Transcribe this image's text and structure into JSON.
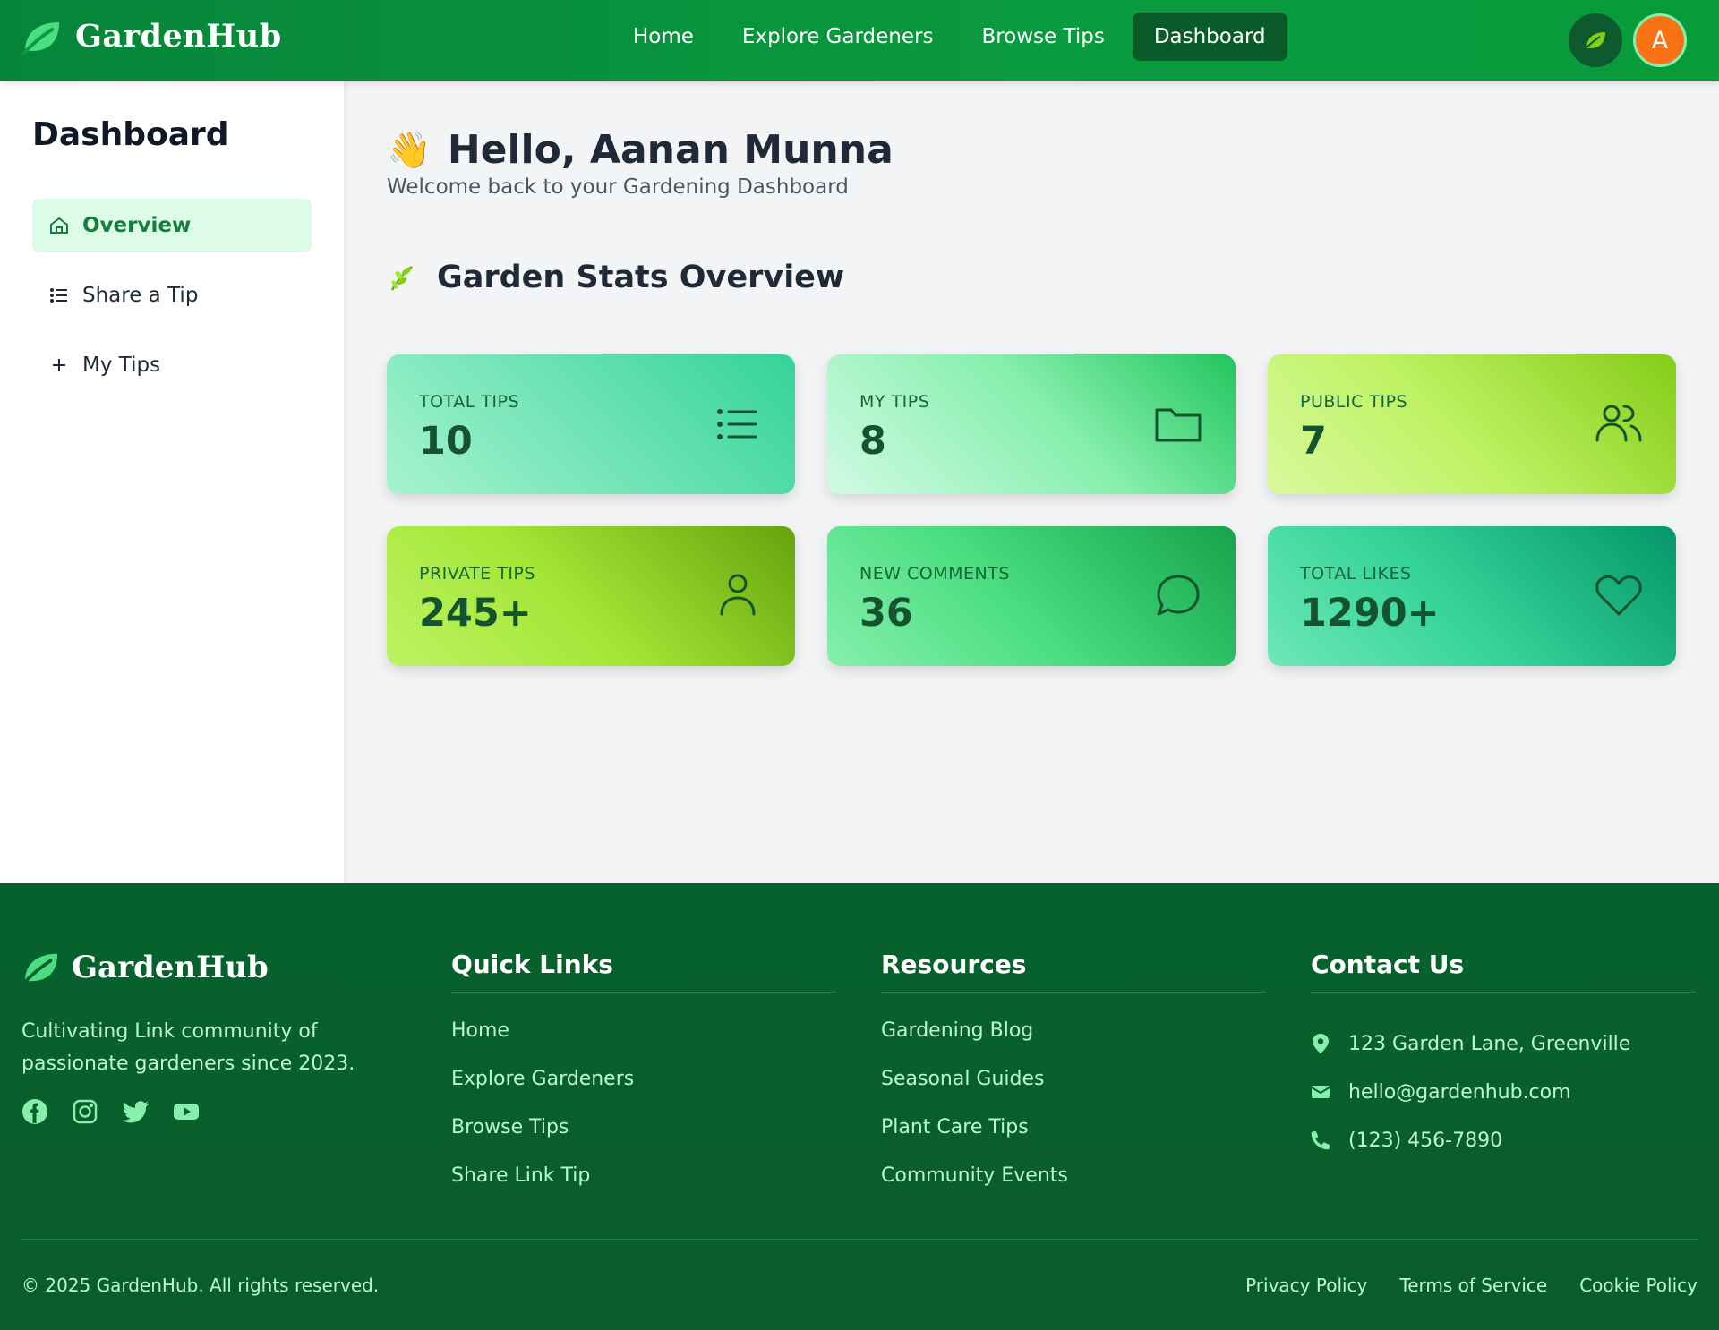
{
  "header": {
    "brand": "GardenHub",
    "nav": [
      {
        "label": "Home"
      },
      {
        "label": "Explore Gardeners"
      },
      {
        "label": "Browse Tips"
      },
      {
        "label": "Dashboard",
        "active": true
      }
    ],
    "avatar_initial": "A"
  },
  "sidebar": {
    "title": "Dashboard",
    "items": [
      {
        "label": "Overview",
        "icon": "home-icon",
        "active": true
      },
      {
        "label": "Share a Tip",
        "icon": "list-icon"
      },
      {
        "label": "My Tips",
        "icon": "plus-icon"
      }
    ]
  },
  "main": {
    "greeting": "Hello, Aanan Munna",
    "welcome": "Welcome back to your Gardening Dashboard",
    "stats_title": "Garden Stats Overview",
    "stats": [
      {
        "label": "TOTAL TIPS",
        "value": "10",
        "icon": "list-icon"
      },
      {
        "label": "MY TIPS",
        "value": "8",
        "icon": "folder-icon"
      },
      {
        "label": "PUBLIC TIPS",
        "value": "7",
        "icon": "users-icon"
      },
      {
        "label": "PRIVATE TIPS",
        "value": "245+",
        "icon": "user-icon"
      },
      {
        "label": "NEW COMMENTS",
        "value": "36",
        "icon": "comment-icon"
      },
      {
        "label": "TOTAL LIKES",
        "value": "1290+",
        "icon": "heart-icon"
      }
    ]
  },
  "footer": {
    "brand": "GardenHub",
    "description": "Cultivating Link community of passionate gardeners since 2023.",
    "social": [
      "facebook-icon",
      "instagram-icon",
      "twitter-icon",
      "youtube-icon"
    ],
    "quick_links": {
      "title": "Quick Links",
      "items": [
        "Home",
        "Explore Gardeners",
        "Browse Tips",
        "Share Link Tip"
      ]
    },
    "resources": {
      "title": "Resources",
      "items": [
        "Gardening Blog",
        "Seasonal Guides",
        "Plant Care Tips",
        "Community Events"
      ]
    },
    "contact": {
      "title": "Contact Us",
      "address": "123 Garden Lane, Greenville",
      "email": "hello@gardenhub.com",
      "phone": "(123) 456-7890"
    },
    "copyright": "© 2025 GardenHub. All rights reserved.",
    "legal": [
      "Privacy Policy",
      "Terms of Service",
      "Cookie Policy"
    ]
  },
  "colors": {
    "primary": "#0a9a3f",
    "dark": "#0b5a2a",
    "accent": "#dcfce7",
    "avatar": "#f97316"
  }
}
